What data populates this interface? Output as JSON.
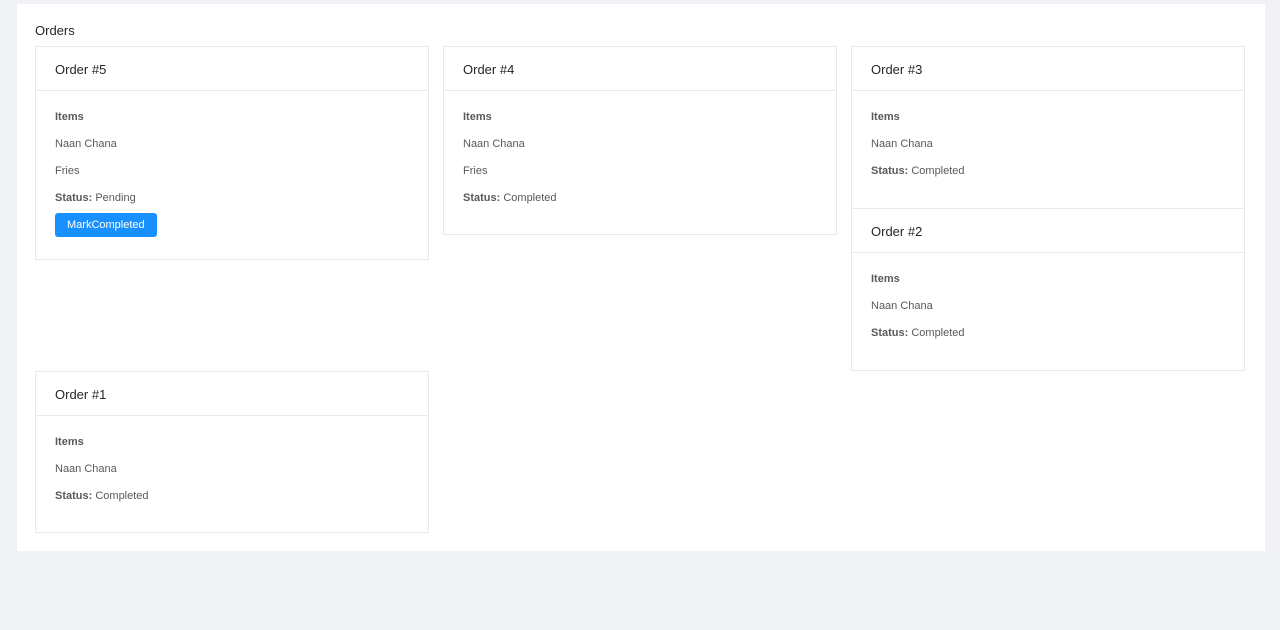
{
  "page": {
    "title": "Orders"
  },
  "labels": {
    "items": "Items",
    "status": "Status:"
  },
  "orders": [
    {
      "title": "Order #5",
      "items": [
        "Naan Chana",
        "Fries"
      ],
      "status": "Pending",
      "action": "MarkCompleted"
    },
    {
      "title": "Order #4",
      "items": [
        "Naan Chana",
        "Fries"
      ],
      "status": "Completed"
    },
    {
      "title": "Order #3",
      "items": [
        "Naan Chana"
      ],
      "status": "Completed"
    },
    {
      "title": "Order #2",
      "items": [
        "Naan Chana"
      ],
      "status": "Completed"
    },
    {
      "title": "Order #1",
      "items": [
        "Naan Chana"
      ],
      "status": "Completed"
    }
  ],
  "colors": {
    "primary": "#1890ff",
    "background": "#f0f2f5",
    "border": "#e9e9e9"
  }
}
